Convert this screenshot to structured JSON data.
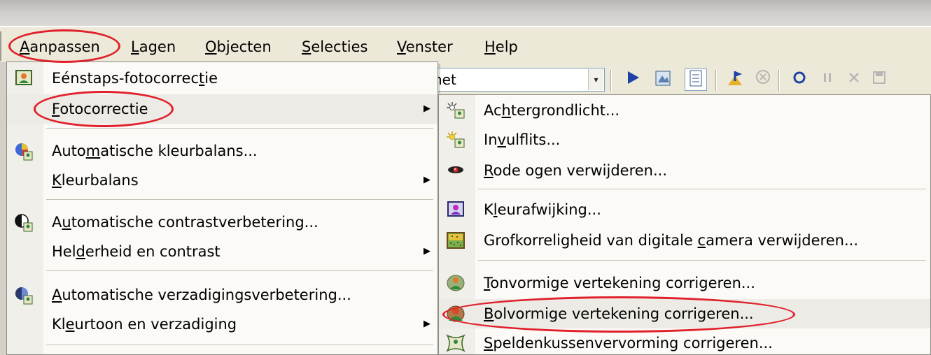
{
  "menubar": {
    "items": [
      {
        "pre": "",
        "key": "A",
        "post": "anpassen"
      },
      {
        "pre": "",
        "key": "L",
        "post": "agen"
      },
      {
        "pre": "",
        "key": "O",
        "post": "bjecten"
      },
      {
        "pre": "",
        "key": "S",
        "post": "electies"
      },
      {
        "pre": "",
        "key": "V",
        "post": "enster"
      },
      {
        "pre": "",
        "key": "H",
        "post": "elp"
      }
    ]
  },
  "toolbar": {
    "combo_value": "net",
    "combo_arrow": "▾",
    "icons": [
      "play-icon",
      "image-edit-icon",
      "document-icon",
      "arrow-flag-icon",
      "stop-circle-icon",
      "record-icon",
      "pause-icon",
      "cancel-icon",
      "save-icon"
    ]
  },
  "main_menu": {
    "items": [
      {
        "pre": "Eénstaps-fotocorrec",
        "key": "t",
        "post": "ie",
        "icon": "photo-person-icon"
      },
      {
        "pre": "",
        "key": "F",
        "post": "otocorrectie",
        "icon": "",
        "submenu": true
      },
      {
        "pre": "Auto",
        "key": "m",
        "post": "atische kleurbalans...",
        "icon": "color-balance-icon"
      },
      {
        "pre": "",
        "key": "K",
        "post": "leurbalans",
        "icon": "",
        "submenu": true
      },
      {
        "pre": "A",
        "key": "u",
        "post": "tomatische contrastverbetering...",
        "icon": "contrast-icon"
      },
      {
        "pre": "Hel",
        "key": "d",
        "post": "erheid en contrast",
        "icon": "",
        "submenu": true
      },
      {
        "pre": "",
        "key": "A",
        "post": "utomatische verzadigingsverbetering...",
        "icon": "saturation-icon"
      },
      {
        "pre": "Kl",
        "key": "e",
        "post": "urtoon en verzadiging",
        "icon": "",
        "submenu": true
      }
    ],
    "submenu_arrow": "▶"
  },
  "sub_menu": {
    "items": [
      {
        "pre": "Ac",
        "key": "h",
        "post": "tergrondlicht...",
        "icon": "backlight-icon"
      },
      {
        "pre": "In",
        "key": "v",
        "post": "ulflits...",
        "icon": "fill-flash-icon"
      },
      {
        "pre": "",
        "key": "R",
        "post": "ode ogen verwijderen...",
        "icon": "red-eye-icon"
      },
      {
        "pre": "K",
        "key": "l",
        "post": "eurafwijking...",
        "icon": "chromatic-aberration-icon"
      },
      {
        "pre": "Grofkorreligheid van digitale ",
        "key": "c",
        "post": "amera verwijderen...",
        "icon": "noise-removal-icon"
      },
      {
        "pre": "",
        "key": "T",
        "post": "onvormige vertekening corrigeren...",
        "icon": "barrel-distortion-icon"
      },
      {
        "pre": "",
        "key": "B",
        "post": "olvormige vertekening corrigeren...",
        "icon": "fisheye-distortion-icon"
      },
      {
        "pre": "",
        "key": "S",
        "post": "peldenkussenvervorming corrigeren...",
        "icon": "pincushion-distortion-icon"
      }
    ]
  },
  "colors": {
    "annotation_red": "#e0202a",
    "menu_bg": "#fbfaf6",
    "highlight_bg": "#ecebe6",
    "toolbar_bg": "#ece9d8"
  }
}
